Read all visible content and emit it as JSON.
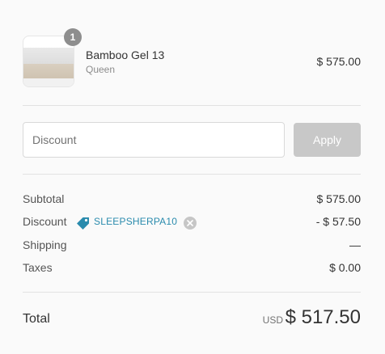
{
  "product": {
    "name": "Bamboo Gel 13",
    "variant": "Queen",
    "price": "$ 575.00",
    "quantity": "1",
    "thumbnail_icon": "mattress-thumbnail"
  },
  "discount_form": {
    "placeholder": "Discount",
    "value": "",
    "apply_label": "Apply"
  },
  "summary": {
    "subtotal_label": "Subtotal",
    "subtotal_value": "$ 575.00",
    "discount_label": "Discount",
    "discount_code": "SLEEPSHERPA10",
    "discount_value": "- $ 57.50",
    "shipping_label": "Shipping",
    "shipping_value": "—",
    "taxes_label": "Taxes",
    "taxes_value": "$ 0.00"
  },
  "total": {
    "label": "Total",
    "currency": "USD",
    "amount": "$ 517.50"
  },
  "colors": {
    "background": "#fafafa",
    "tag_accent": "#2a8bad",
    "button_disabled": "#c8c8c8",
    "badge": "#8e8e8e"
  }
}
